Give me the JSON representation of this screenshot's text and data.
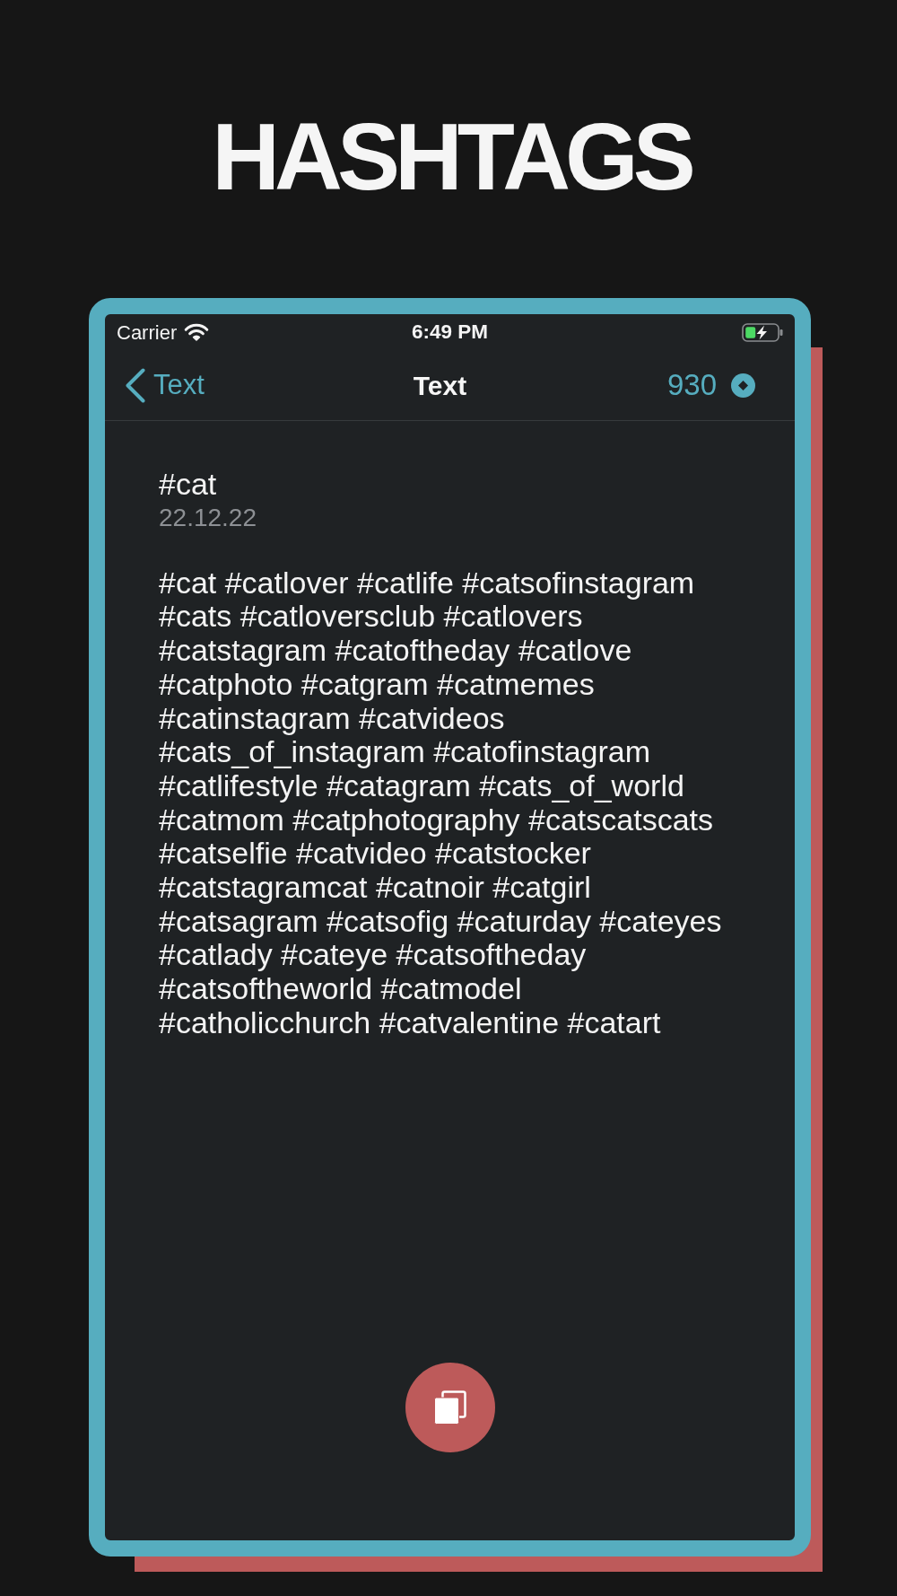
{
  "heading": "HASHTAGS",
  "status_bar": {
    "carrier": "Carrier",
    "time": "6:49 PM"
  },
  "nav_bar": {
    "back_label": "Text",
    "title": "Text",
    "count": "930"
  },
  "note": {
    "title": "#cat",
    "date": "22.12.22",
    "body": "#cat #catlover #catlife #catsofinstagram\n#cats #catloversclub #catlovers\n#catstagram #catoftheday #catlove\n#catphoto #catgram #catmemes\n#catinstagram #catvideos\n#cats_of_instagram #catofinstagram\n#catlifestyle #catagram #cats_of_world\n#catmom #catphotography #catscatscats\n#catselfie #catvideo #catstocker\n#catstagramcat #catnoir #catgirl\n#catsagram #catsofig #caturday #cateyes\n#catlady #cateye #catsoftheday\n#catsoftheworld #catmodel\n#catholicchurch #catvalentine #catart"
  }
}
